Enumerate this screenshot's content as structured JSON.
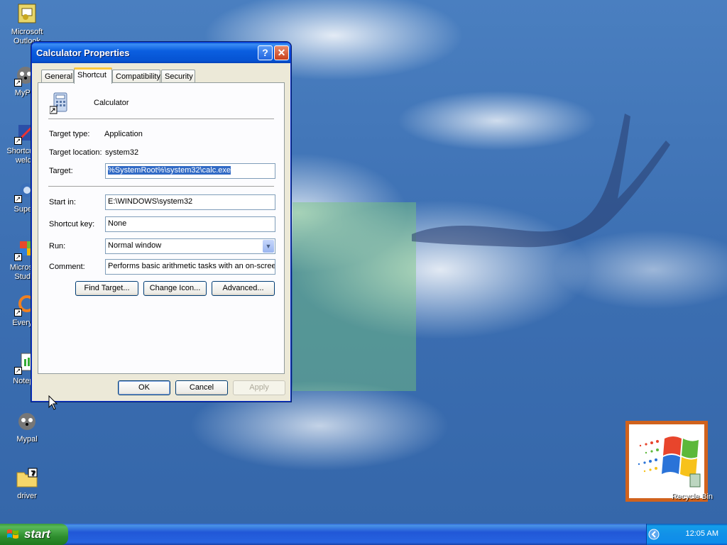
{
  "desktop": {
    "icons": [
      {
        "label": "Microsoft Outlook",
        "icon": "outlook-icon"
      },
      {
        "label": "MyPal",
        "icon": "mypal-icon"
      },
      {
        "label": "Shortcut to welco",
        "icon": "shortcut-icon"
      },
      {
        "label": "Superr",
        "icon": "super-icon"
      },
      {
        "label": "Microsoft Studio",
        "icon": "studio-icon"
      },
      {
        "label": "Everyth",
        "icon": "everything-icon"
      },
      {
        "label": "Notepa",
        "icon": "notepad-icon"
      },
      {
        "label": "Mypal",
        "icon": "mypal-icon"
      },
      {
        "label": "driver",
        "icon": "folder-icon"
      }
    ],
    "recycle_bin_label": "Recycle Bin"
  },
  "dialog": {
    "title": "Calculator Properties",
    "tabs": [
      "General",
      "Shortcut",
      "Compatibility",
      "Security"
    ],
    "active_tab": "Shortcut",
    "app_name": "Calculator",
    "target_type_label": "Target type:",
    "target_type_value": "Application",
    "target_location_label": "Target location:",
    "target_location_value": "system32",
    "target_label": "Target:",
    "target_value": "%SystemRoot%\\system32\\calc.exe",
    "start_in_label": "Start in:",
    "start_in_value": "E:\\WINDOWS\\system32",
    "shortcut_key_label": "Shortcut key:",
    "shortcut_key_value": "None",
    "run_label": "Run:",
    "run_value": "Normal window",
    "comment_label": "Comment:",
    "comment_value": "Performs basic arithmetic tasks with an on-screen",
    "find_target_label": "Find Target...",
    "change_icon_label": "Change Icon...",
    "advanced_label": "Advanced...",
    "ok_label": "OK",
    "cancel_label": "Cancel",
    "apply_label": "Apply"
  },
  "taskbar": {
    "start_label": "start",
    "clock": "12:05 AM"
  },
  "colors": {
    "titlebar": "#0b5fe0",
    "taskbar": "#2157d7",
    "start_button": "#2f8f2f",
    "selection": "#316ac5"
  }
}
